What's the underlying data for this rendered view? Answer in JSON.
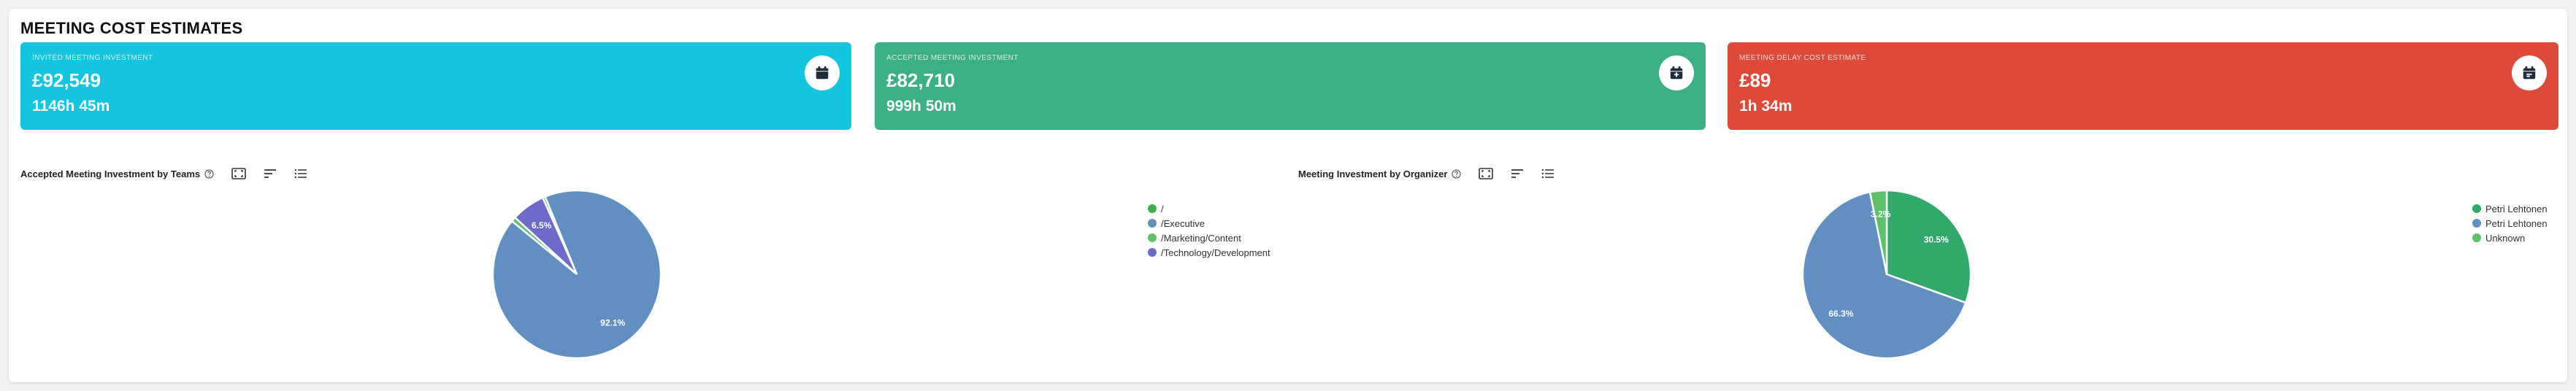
{
  "page": {
    "title": "MEETING COST ESTIMATES"
  },
  "cards": [
    {
      "label": "INVITED MEETING INVESTMENT",
      "value": "£92,549",
      "sub": "1146h 45m",
      "color": "#13c5de",
      "icon": "calendar-icon"
    },
    {
      "label": "ACCEPTED MEETING INVESTMENT",
      "value": "£82,710",
      "sub": "999h 50m",
      "color": "#3daf85",
      "icon": "calendar-check-icon"
    },
    {
      "label": "MEETING DELAY COST ESTIMATE",
      "value": "£89",
      "sub": "1h 34m",
      "color": "#de4a3a",
      "icon": "calendar-clock-icon"
    }
  ],
  "charts": {
    "teams": {
      "title": "Accepted Meeting Investment by Teams"
    },
    "organizer": {
      "title": "Meeting Investment by Organizer"
    }
  },
  "chart_data": [
    {
      "type": "pie",
      "title": "Accepted Meeting Investment by Teams",
      "categories": [
        "/",
        "/Executive",
        "/Marketing/Content",
        "/Technology/Development"
      ],
      "values": [
        0.5,
        92.1,
        0.9,
        6.5
      ],
      "labels": [
        "",
        "92.1%",
        "",
        "6.5%"
      ],
      "colors": [
        "#3fae4a",
        "#628fc1",
        "#5fc16b",
        "#6d6ac9"
      ],
      "legend": "right"
    },
    {
      "type": "pie",
      "title": "Meeting Investment by Organizer",
      "categories": [
        "Petri Lehtonen",
        "Petri Lehtonen",
        "Unknown"
      ],
      "values": [
        30.5,
        66.3,
        3.2
      ],
      "labels": [
        "30.5%",
        "66.3%",
        "3.2%"
      ],
      "colors": [
        "#33a86b",
        "#628fc1",
        "#5cc167"
      ],
      "legend": "right"
    }
  ]
}
